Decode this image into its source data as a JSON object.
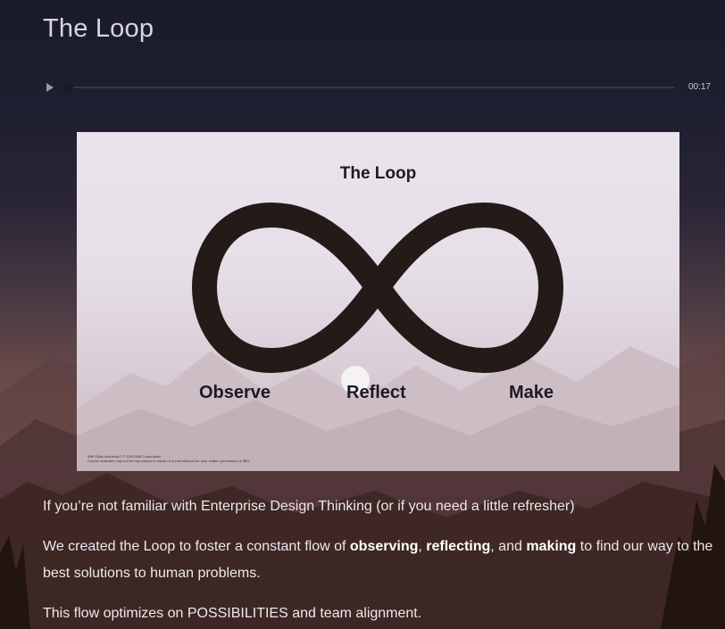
{
  "page": {
    "title": "The Loop"
  },
  "player": {
    "time": "00:17",
    "progress": 0.0,
    "play_icon": "play-icon"
  },
  "slide": {
    "title": "The Loop",
    "labels": {
      "observe": "Observe",
      "reflect": "Reflect",
      "make": "Make"
    },
    "footer_line1": "IBM Skills Academy© © 2023 IBM Corporation",
    "footer_line2": "Course materials may not be reproduced in whole or in part without the prior written permission of IBM."
  },
  "body": {
    "p1": "If you’re not familiar with Enterprise Design Thinking (or if you need a little refresher)",
    "p2_a": "We created the Loop to foster a constant flow of ",
    "p2_b": "observing",
    "p2_c": ", ",
    "p2_d": "reflecting",
    "p2_e": ", and ",
    "p2_f": "making",
    "p2_g": " to find our way to the best solutions to human problems.",
    "p3": "This flow optimizes on POSSIBILITIES and team alignment."
  },
  "colors": {
    "sky_top": "#191b2a",
    "sunset": "#7a5448",
    "slide_bg": "#e9e3ec",
    "loop": "#241a18"
  }
}
